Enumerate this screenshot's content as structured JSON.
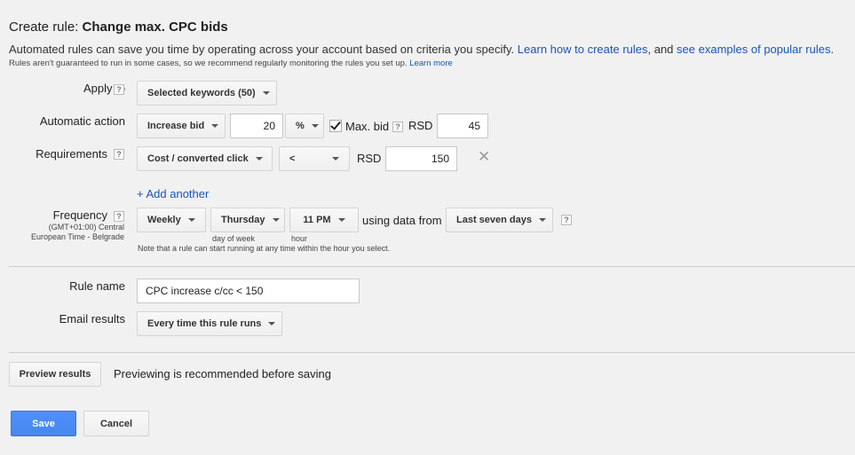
{
  "header": {
    "prefix": "Create rule:",
    "rule_title": "Change max. CPC bids",
    "description": "Automated rules can save you time by operating across your account based on criteria you specify.",
    "learn_link": "Learn how to create rules",
    "and_text": ", and",
    "examples_link": "see examples of popular rules",
    "period": ".",
    "note": "Rules aren't guaranteed to run in some cases, so we recommend regularly monitoring the rules you set up.",
    "learn_more": "Learn more"
  },
  "help_glyph": "?",
  "apply_to": {
    "label": "Apply to",
    "value": "Selected keywords (50)"
  },
  "action": {
    "label": "Automatic action",
    "type": "Increase bid",
    "amount": "20",
    "unit": "%",
    "max_bid_label": "Max. bid",
    "max_bid_checked": true,
    "currency": "RSD",
    "max_bid_value": "45"
  },
  "requirements": {
    "label": "Requirements",
    "metric": "Cost / converted click",
    "operator": "<",
    "currency": "RSD",
    "value": "150",
    "remove_icon": "close-icon"
  },
  "add_another": "+ Add another",
  "frequency": {
    "label": "Frequency",
    "timezone_line1": "(GMT+01:00) Central",
    "timezone_line2": "European Time - Belgrade",
    "period": "Weekly",
    "day": "Thursday",
    "day_caption": "day of week",
    "hour": "11 PM",
    "hour_caption": "hour",
    "using_data_from": "using data from",
    "data_range": "Last seven days",
    "note": "Note that a rule can start running at any time within the hour you select."
  },
  "rule_name": {
    "label": "Rule name",
    "value": "CPC increase c/cc < 150"
  },
  "email": {
    "label": "Email results",
    "value": "Every time this rule runs"
  },
  "preview": {
    "button": "Preview results",
    "hint": "Previewing is recommended before saving"
  },
  "footer": {
    "save": "Save",
    "cancel": "Cancel"
  },
  "colors": {
    "link": "#1a55b5",
    "primary": "#4d90fe",
    "background": "#f1f1f1"
  }
}
